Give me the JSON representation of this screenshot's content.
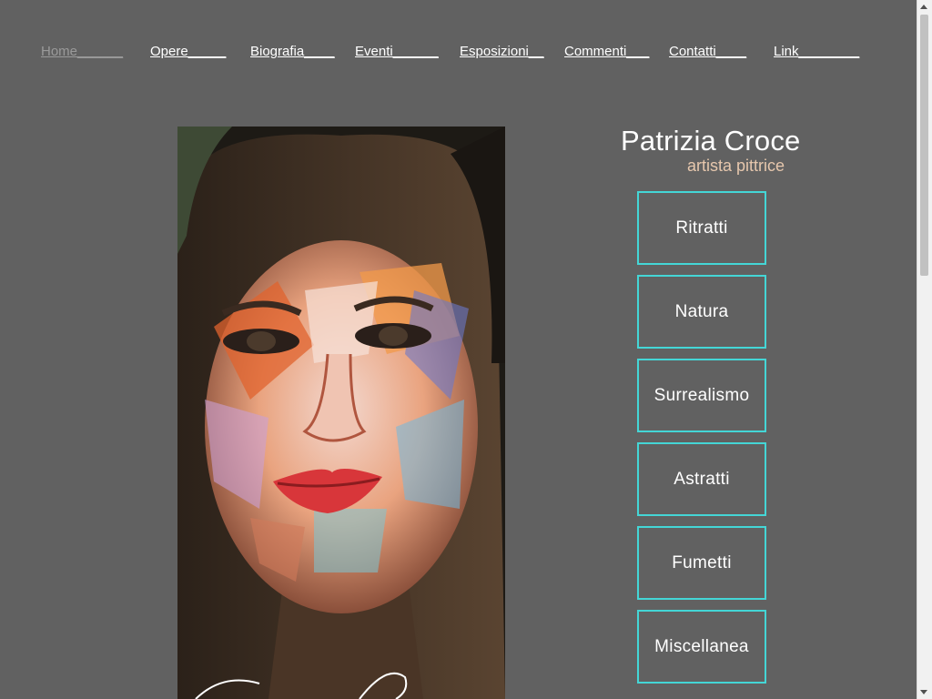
{
  "nav": {
    "items": [
      {
        "label": "Home______"
      },
      {
        "label": "Opere_____"
      },
      {
        "label": "Biografia____"
      },
      {
        "label": "Eventi______"
      },
      {
        "label": "Esposizioni__"
      },
      {
        "label": "Commenti___"
      },
      {
        "label": "Contatti____"
      },
      {
        "label": "Link________"
      }
    ],
    "active_index": 0,
    "active_color": "#9a9a9a",
    "link_color": "#ffffff"
  },
  "brand": {
    "name": "Patrizia Croce",
    "subtitle": "artista pittrice",
    "subtitle_color": "#e6c7ad"
  },
  "categories": [
    {
      "label": "Ritratti"
    },
    {
      "label": "Natura"
    },
    {
      "label": "Surrealismo"
    },
    {
      "label": "Astratti"
    },
    {
      "label": "Fumetti"
    },
    {
      "label": "Miscellanea"
    }
  ],
  "colors": {
    "background": "#616161",
    "category_border": "#44d6d6"
  },
  "hero_image": {
    "subject": "painted portrait of a woman"
  }
}
